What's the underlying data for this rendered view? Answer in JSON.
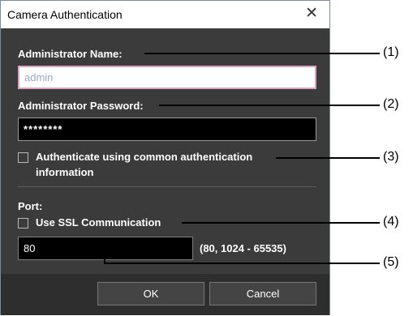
{
  "dialog": {
    "title": "Camera Authentication",
    "close_glyph": "✕",
    "admin_name_label": "Administrator Name:",
    "admin_name_value": "admin",
    "admin_password_label": "Administrator Password:",
    "admin_password_value": "********",
    "common_auth_label_line1": "Authenticate using common authentication",
    "common_auth_label_line2": "information",
    "port_label": "Port:",
    "ssl_label": "Use SSL Communication",
    "port_value": "80",
    "port_range": "(80, 1024 - 65535)",
    "ok_label": "OK",
    "cancel_label": "Cancel"
  },
  "callouts": [
    "(1)",
    "(2)",
    "(3)",
    "(4)",
    "(5)"
  ],
  "colors": {
    "dialog_bg": "#3b3b3b",
    "titlebar_bg": "#ffffff",
    "name_field_border": "#d9a3c2"
  }
}
